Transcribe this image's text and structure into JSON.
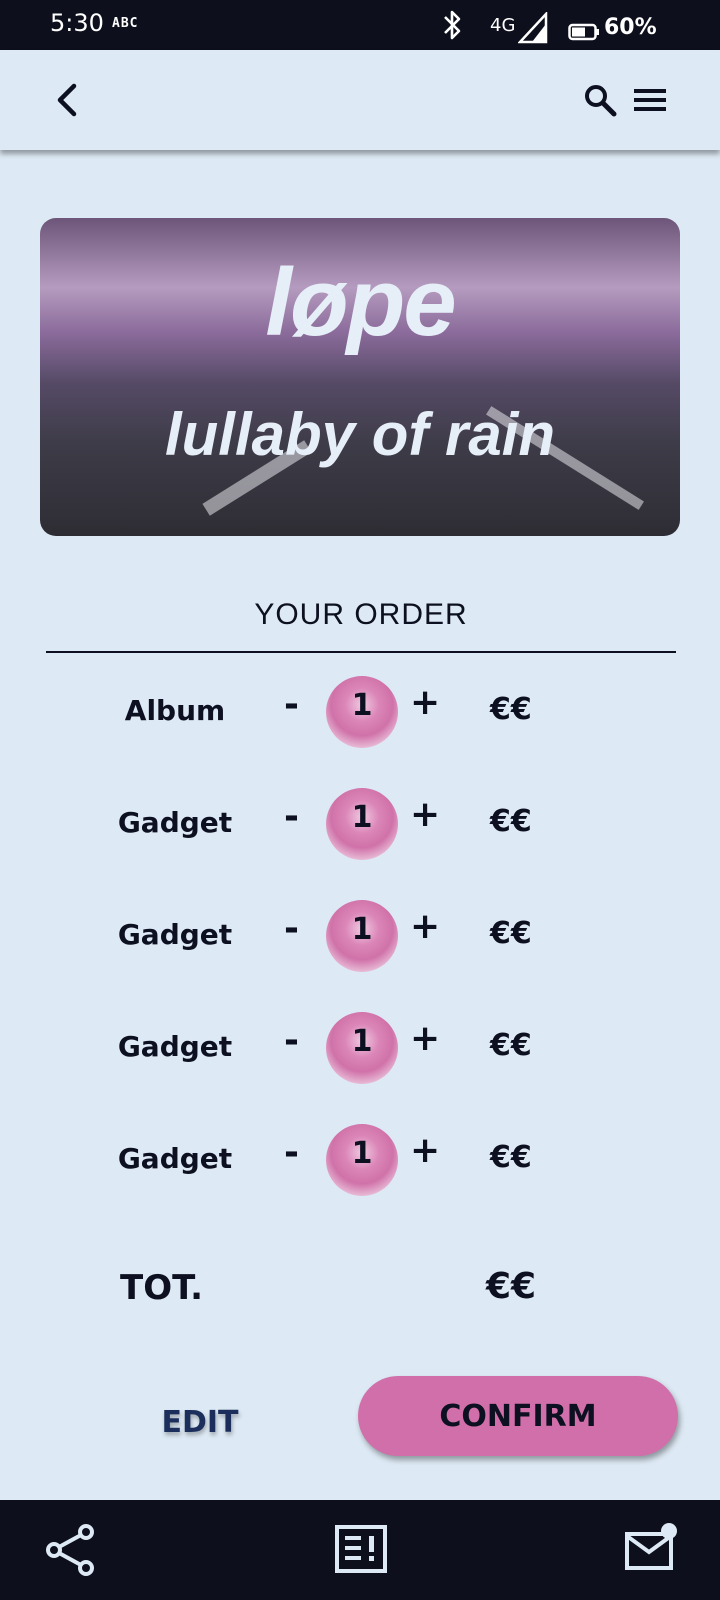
{
  "status_bar": {
    "time": "5:30",
    "carrier": "ABC",
    "network": "4G",
    "battery_percent": "60%",
    "icons": [
      "bluetooth-icon",
      "signal-icon",
      "battery-icon"
    ]
  },
  "app_bar": {
    "icons": [
      "back-arrow-icon",
      "search-icon",
      "menu-icon"
    ]
  },
  "banner": {
    "brand": "løpe",
    "subtitle": "lullaby of rain"
  },
  "order": {
    "title": "YOUR ORDER",
    "items": [
      {
        "name": "Album",
        "minus": "-",
        "qty": "1",
        "plus": "+",
        "price": "€€"
      },
      {
        "name": "Gadget",
        "minus": "-",
        "qty": "1",
        "plus": "+",
        "price": "€€"
      },
      {
        "name": "Gadget",
        "minus": "-",
        "qty": "1",
        "plus": "+",
        "price": "€€"
      },
      {
        "name": "Gadget",
        "minus": "-",
        "qty": "1",
        "plus": "+",
        "price": "€€"
      },
      {
        "name": "Gadget",
        "minus": "-",
        "qty": "1",
        "plus": "+",
        "price": "€€"
      }
    ],
    "total_label": "TOT.",
    "total_value": "€€"
  },
  "actions": {
    "edit_label": "EDIT",
    "confirm_label": "CONFIRM"
  },
  "bottom_nav": {
    "icons": [
      "share-icon",
      "newspaper-icon",
      "mail-notification-icon"
    ]
  },
  "colors": {
    "background": "#dde9f4",
    "dark": "#0d101c",
    "accent": "#d06fa9",
    "edit_text": "#1c2f5c"
  }
}
